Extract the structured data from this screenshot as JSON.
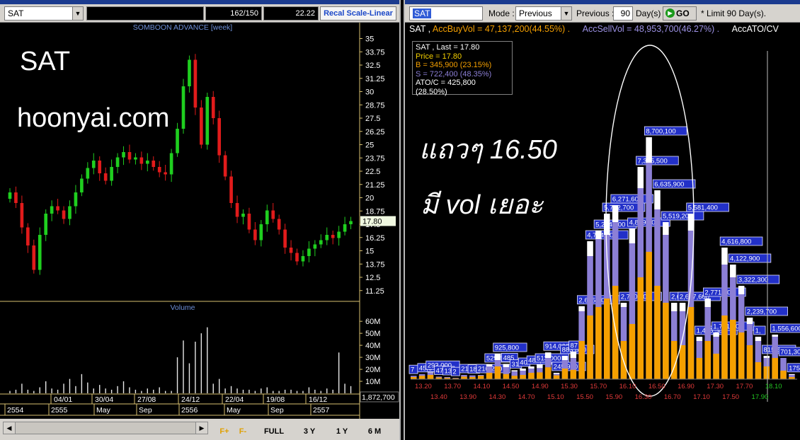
{
  "left": {
    "symbol": "SAT",
    "counter": "162/150",
    "last_value": "22.22",
    "recal_button": "Recal Scale-Linear",
    "chart_title": "SOMBOON ADVANCE [week]",
    "volume_title": "Volume",
    "price_tag": "17.80",
    "volume_tag": "1,872,700",
    "overlay_line1": "SAT",
    "overlay_line2": "hoonyai.com",
    "date_labels": [
      "04/01",
      "30/04",
      "27/08",
      "24/12",
      "22/04",
      "19/08",
      "16/12"
    ],
    "year_labels": [
      "2554",
      "2555",
      "May",
      "Sep",
      "2556",
      "May",
      "Sep",
      "2557"
    ],
    "bottom_buttons": [
      "FULL",
      "3 Y",
      "1 Y",
      "6 M"
    ],
    "zoom_in": "F+",
    "zoom_out": "F-",
    "colors": {
      "up": "#1fcf1f",
      "down": "#e11b1b",
      "axis": "#d8c070"
    }
  },
  "right": {
    "symbol": "SAT",
    "mode_label": "Mode :",
    "mode_value": "Previous",
    "previous_label": "Previous :",
    "previous_value": "90",
    "days_label": "Day(s)",
    "go_label": "GO",
    "limit_text": "* Limit 90 Day(s).",
    "summary_symbol": "SAT ,",
    "acc_buy": "AccBuyVol = 47,137,200(44.55%) .",
    "acc_sell": "AccSellVol = 48,953,700(46.27%) .",
    "acc_ato": "AccATO/CV",
    "info": {
      "last": "SAT , Last = 17.80",
      "price": "Price = 17.80",
      "buy": "B = 345,900 (23.15%)",
      "sell": "S = 722,400 (48.35%)",
      "atoc": "ATO/C = 425,800 (28.50%)"
    },
    "overlay_line1": "แถวๆ 16.50",
    "overlay_line2": "มี vol เยอะ",
    "colors": {
      "buy": "#f5a000",
      "sell": "#8c7fd6",
      "ato": "#ffffff",
      "label_bg": "#2230c8"
    }
  },
  "chart_data": [
    {
      "type": "candlestick",
      "title": "SOMBOON ADVANCE [week]",
      "ylim": [
        10.5,
        35.7
      ],
      "y_ticks": [
        "35",
        "33.75",
        "32.5",
        "31.25",
        "30",
        "28.75",
        "27.5",
        "26.25",
        "25",
        "23.75",
        "22.5",
        "21.25",
        "20",
        "18.75",
        "17.5",
        "16.25",
        "15",
        "13.75",
        "12.5",
        "11.25"
      ],
      "y_tick_values": [
        35,
        33.75,
        32.5,
        31.25,
        30,
        28.75,
        27.5,
        26.25,
        25,
        23.75,
        22.5,
        21.25,
        20,
        18.75,
        17.5,
        16.25,
        15,
        13.75,
        12.5,
        11.25
      ],
      "close_path": [
        20.5,
        19.5,
        17.2,
        15.5,
        13.2,
        16.5,
        18.5,
        19.2,
        18.8,
        18.0,
        19.2,
        20.5,
        21.8,
        22.8,
        23.5,
        22.3,
        21.6,
        22.9,
        23.8,
        24.3,
        23.6,
        23.8,
        23.2,
        23.5,
        22.9,
        22.4,
        22.2,
        24.2,
        26.5,
        30.5,
        33.0,
        28.5,
        25.0,
        29.5,
        27.5,
        24.0,
        22.0,
        19.5,
        18.2,
        18.5,
        17.0,
        16.0,
        17.5,
        18.8,
        18.0,
        17.0,
        15.3,
        14.8,
        14.0,
        14.5,
        15.2,
        15.6,
        16.0,
        16.5,
        16.2,
        16.8,
        17.5,
        17.8
      ],
      "volume_axis": [
        "60M",
        "50M",
        "40M",
        "30M",
        "20M",
        "10M"
      ],
      "volume_tick_values": [
        60,
        50,
        40,
        30,
        20,
        10
      ],
      "volume_m": [
        2,
        3,
        8,
        3,
        2,
        5,
        10,
        4,
        3,
        8,
        12,
        6,
        16,
        9,
        4,
        7,
        4,
        3,
        6,
        10,
        5,
        3,
        2,
        4,
        3,
        5,
        2,
        2,
        30,
        44,
        25,
        43,
        50,
        55,
        8,
        12,
        4,
        6,
        4,
        3,
        3,
        2,
        4,
        5,
        2,
        2,
        3,
        3,
        2,
        2,
        5,
        3,
        2,
        4,
        3,
        34,
        8,
        6
      ]
    },
    {
      "type": "bar",
      "stacked": true,
      "x_top_labels": [
        "13.20",
        "13.70",
        "14.10",
        "14.50",
        "14.90",
        "15.30",
        "15.70",
        "16.10",
        "16.50",
        "16.90",
        "17.30",
        "17.70",
        "18.10"
      ],
      "x_bottom_labels": [
        "13.40",
        "13.90",
        "14.30",
        "14.70",
        "15.10",
        "15.50",
        "15.90",
        "16.30",
        "16.70",
        "17.10",
        "17.50",
        "17.90"
      ],
      "bar_labels": [
        "7",
        "45,8",
        "293,000",
        "47",
        "13",
        "2",
        "21,800",
        "18",
        "210,200",
        "529,5",
        "925,800",
        "485",
        "31",
        "40",
        "481,5",
        "513,000",
        "914,000",
        "245,900",
        "883,800",
        "87",
        "2,615,100",
        "4,784,100",
        "5,204,500",
        "5,792,700",
        "6,271,600",
        "2,710,100",
        "4,859,100",
        "7,385,500",
        "8,700,100",
        "6,635,900",
        "5,519,200",
        "2,68",
        "2,627,600",
        "5,581,400",
        "1,485,500",
        "2,771,900",
        "1,701,300",
        "4,616,800",
        "4,122,900",
        "3,322,300",
        "2,239,700",
        "1,",
        "815,600",
        "1,556,600",
        "701,300",
        "175,000"
      ],
      "buy": [
        0.05,
        0.08,
        0.1,
        0.04,
        0.03,
        0.02,
        0.06,
        0.05,
        0.08,
        0.15,
        0.3,
        0.12,
        0.08,
        0.1,
        0.15,
        0.16,
        0.28,
        0.09,
        0.25,
        0.22,
        0.9,
        1.5,
        1.7,
        1.9,
        2.2,
        0.9,
        1.3,
        2.4,
        3.0,
        2.2,
        1.8,
        0.9,
        0.8,
        1.7,
        0.5,
        0.9,
        0.6,
        1.5,
        1.4,
        1.1,
        0.8,
        0.4,
        0.3,
        0.5,
        0.2,
        0.05
      ],
      "sell": [
        0.08,
        0.12,
        0.16,
        0.06,
        0.05,
        0.03,
        0.1,
        0.09,
        0.1,
        0.3,
        0.45,
        0.28,
        0.18,
        0.2,
        0.25,
        0.26,
        0.5,
        0.12,
        0.45,
        0.5,
        1.6,
        2.9,
        3.3,
        3.4,
        3.7,
        1.7,
        3.2,
        4.5,
        5.1,
        4.0,
        3.4,
        1.6,
        1.6,
        3.5,
        0.9,
        1.7,
        1.0,
        2.7,
        2.4,
        2.0,
        1.3,
        0.9,
        0.5,
        1.0,
        0.5,
        0.1
      ],
      "ato": [
        0.0,
        0.0,
        0.02,
        0.0,
        0.0,
        0.0,
        0.0,
        0.0,
        0.0,
        0.05,
        0.15,
        0.08,
        0.03,
        0.05,
        0.05,
        0.09,
        0.13,
        0.03,
        0.1,
        0.15,
        0.12,
        0.35,
        0.2,
        0.5,
        0.4,
        0.1,
        0.35,
        0.5,
        0.6,
        0.45,
        0.3,
        0.2,
        0.2,
        0.4,
        0.1,
        0.2,
        0.1,
        0.4,
        0.3,
        0.2,
        0.15,
        0.1,
        0.05,
        0.05,
        0.0,
        0.02
      ]
    }
  ]
}
